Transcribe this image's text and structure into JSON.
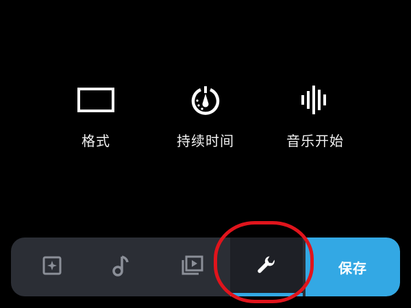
{
  "options": [
    {
      "label": "格式",
      "icon": "aspect-ratio-icon"
    },
    {
      "label": "持续时间",
      "icon": "timer-icon"
    },
    {
      "label": "音乐开始",
      "icon": "waveform-icon"
    }
  ],
  "toolbar": {
    "tools": [
      {
        "icon": "sparkle-image-icon"
      },
      {
        "icon": "music-note-icon"
      },
      {
        "icon": "video-play-icon"
      },
      {
        "icon": "wrench-icon",
        "active": true
      }
    ],
    "save_label": "保存"
  },
  "colors": {
    "background": "#000000",
    "bar": "#2b2e35",
    "active_tool": "#1e2026",
    "accent": "#33a8e4",
    "highlight": "#e0141c"
  }
}
